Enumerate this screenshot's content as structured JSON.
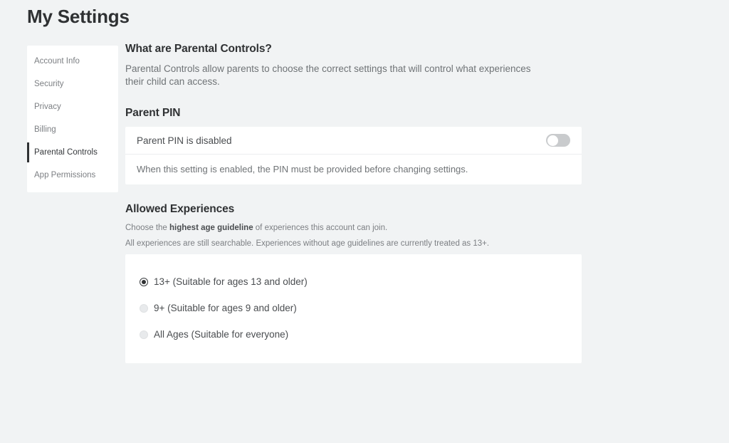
{
  "page": {
    "title": "My Settings"
  },
  "sidebar": {
    "items": [
      {
        "label": "Account Info",
        "active": false
      },
      {
        "label": "Security",
        "active": false
      },
      {
        "label": "Privacy",
        "active": false
      },
      {
        "label": "Billing",
        "active": false
      },
      {
        "label": "Parental Controls",
        "active": true
      },
      {
        "label": "App Permissions",
        "active": false
      }
    ]
  },
  "main": {
    "about": {
      "heading": "What are Parental Controls?",
      "body": "Parental Controls allow parents to choose the correct settings that will control what experiences their child can access."
    },
    "parent_pin": {
      "heading": "Parent PIN",
      "status_label": "Parent PIN is disabled",
      "toggle": {
        "state": "off",
        "track_color": "#c9cbcd",
        "knob_color": "#ffffff"
      },
      "note": "When this setting is enabled, the PIN must be provided before changing settings."
    },
    "allowed_experiences": {
      "heading": "Allowed Experiences",
      "note_line1_prefix": "Choose the ",
      "note_line1_bold": "highest age guideline",
      "note_line1_suffix": " of experiences this account can join.",
      "note_line2": "All experiences are still searchable. Experiences without age guidelines are currently treated as 13+.",
      "options": [
        {
          "label": "13+ (Suitable for ages 13 and older)",
          "selected": true
        },
        {
          "label": "9+ (Suitable for ages 9 and older)",
          "selected": false
        },
        {
          "label": "All Ages (Suitable for everyone)",
          "selected": false
        }
      ]
    }
  },
  "colors": {
    "page_background": "#f1f3f4",
    "card_background": "#ffffff",
    "heading_text": "#2f3133",
    "body_text": "#4a4d50",
    "muted_text": "#7c7f83",
    "active_indicator": "#2f3133",
    "divider": "#eceef0"
  }
}
